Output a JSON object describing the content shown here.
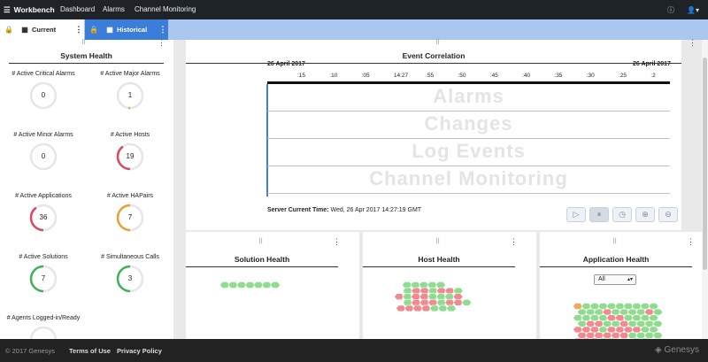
{
  "app": {
    "brand": "Workbench",
    "nav": [
      "Dashboard",
      "Alarms",
      "Channel Monitoring"
    ]
  },
  "tabs": [
    {
      "label": "Current"
    },
    {
      "label": "Historical"
    }
  ],
  "system_health": {
    "title": "System Health",
    "metrics": [
      {
        "label": "# Active Critical Alarms",
        "value": "0",
        "fraction": 0.0,
        "color": "#cfcfcf"
      },
      {
        "label": "# Active Major Alarms",
        "value": "1",
        "fraction": 0.02,
        "color": "#e5a23b"
      },
      {
        "label": "# Active Minor Alarms",
        "value": "0",
        "fraction": 0.0,
        "color": "#cfcfcf"
      },
      {
        "label": "# Active Hosts",
        "value": "19",
        "fraction": 0.4,
        "color": "#d84a5e"
      },
      {
        "label": "# Active Applications",
        "value": "36",
        "fraction": 0.4,
        "color": "#d84a5e"
      },
      {
        "label": "# Active HAPairs",
        "value": "7",
        "fraction": 0.5,
        "color": "#e5a23b"
      },
      {
        "label": "# Active Solutions",
        "value": "7",
        "fraction": 0.5,
        "color": "#3fb15b"
      },
      {
        "label": "# Simultaneous Calls",
        "value": "3",
        "fraction": 0.5,
        "color": "#3fb15b"
      },
      {
        "label": "# Agents Logged-in/Ready",
        "value": "",
        "fraction": 0.0,
        "color": "#cfcfcf"
      }
    ]
  },
  "event_correlation": {
    "title": "Event Correlation",
    "date_left": "26 April 2017",
    "date_right": "26 April 2017",
    "ticks": [
      ":15",
      ":10",
      ":05",
      "14:27",
      ":55",
      ":50",
      ":45",
      ":40",
      ":35",
      ":30",
      ":25",
      ":2"
    ],
    "lanes": [
      "Alarms",
      "Changes",
      "Log Events",
      "Channel Monitoring"
    ],
    "server_time_label": "Server Current Time:",
    "server_time_value": "Wed, 26 Apr 2017 14:27:19 GMT",
    "controls": [
      "play-icon",
      "pause-icon",
      "clock-icon",
      "zoom-in-icon",
      "zoom-out-icon"
    ]
  },
  "solution_health": {
    "title": "Solution Health"
  },
  "host_health": {
    "title": "Host Health"
  },
  "application_health": {
    "title": "Application Health",
    "filter": "All"
  },
  "colors": {
    "green": "#8fdc8f",
    "red": "#f08a8f",
    "orange": "#f0a860",
    "accent": "#3b7dd8"
  },
  "footer": {
    "copyright": "© 2017 Genesys",
    "links": [
      "Terms of Use",
      "Privacy Policy"
    ],
    "brand": "Genesys"
  }
}
